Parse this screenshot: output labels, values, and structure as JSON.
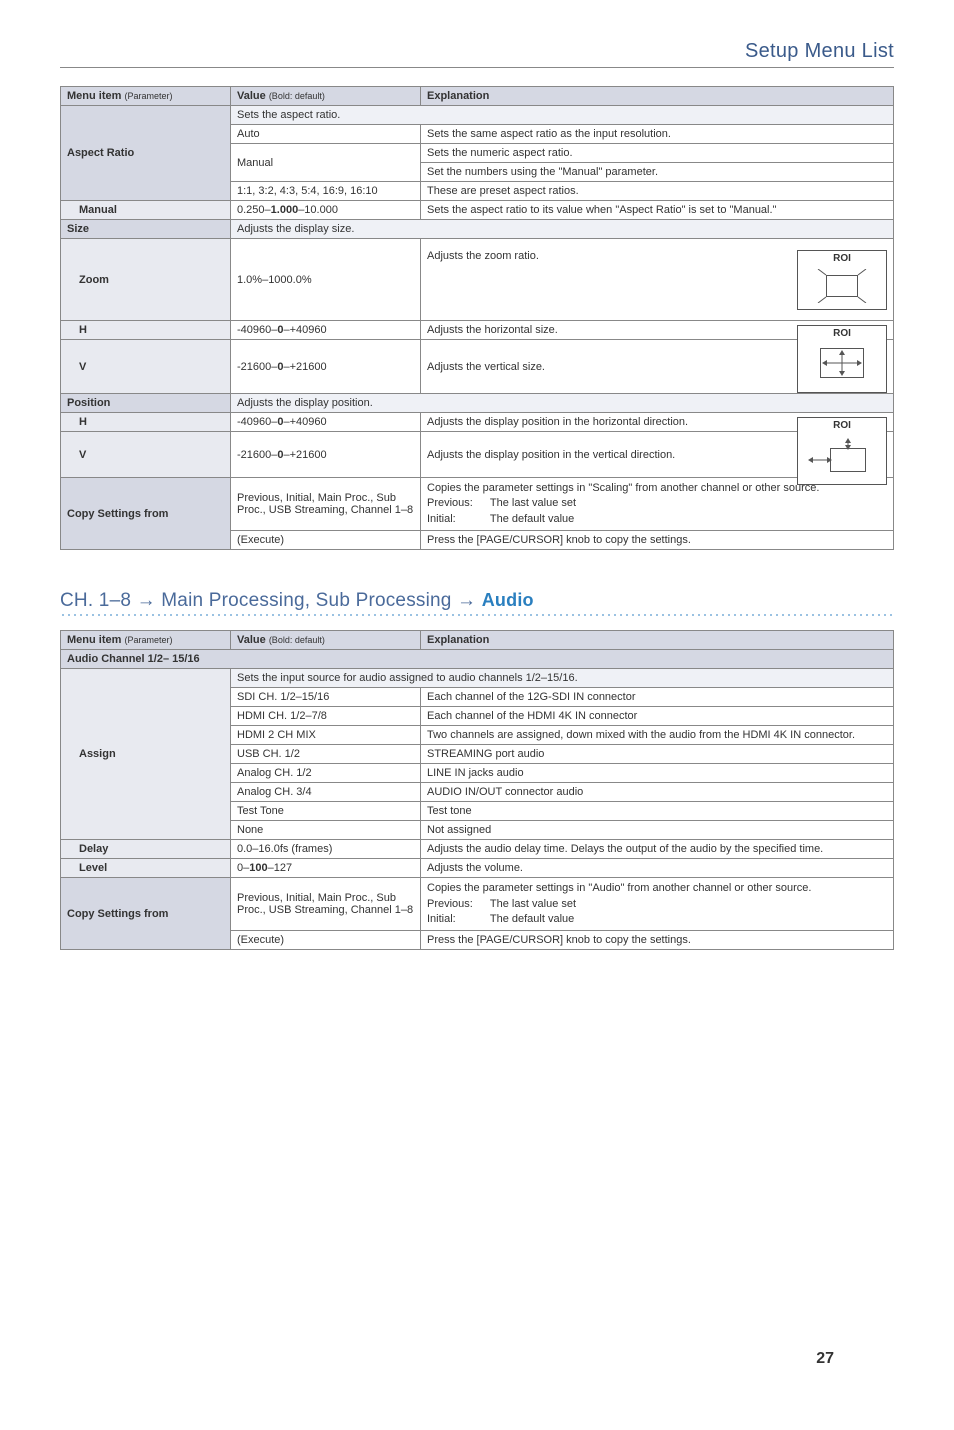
{
  "header": {
    "title": "Setup Menu List"
  },
  "columns": {
    "menu_item": "Menu item",
    "menu_item_sub": "(Parameter)",
    "value": "Value",
    "value_sub": "(Bold: default)",
    "explanation": "Explanation"
  },
  "table1": {
    "aspect_ratio": {
      "label": "Aspect Ratio",
      "intro": "Sets the aspect ratio.",
      "rows": [
        {
          "value": "Auto",
          "exp": "Sets the same aspect ratio as the input resolution."
        },
        {
          "value": "Manual",
          "exp1": "Sets the numeric aspect ratio.",
          "exp2": "Set the numbers using the \"Manual\" parameter."
        },
        {
          "value": "1:1, 3:2, 4:3, 5:4, 16:9, 16:10",
          "exp": "These are preset aspect ratios."
        }
      ],
      "manual": {
        "label": "Manual",
        "value_pre": "0.250–",
        "value_bold": "1.000",
        "value_post": "–10.000",
        "exp": "Sets the aspect ratio to its value when \"Aspect Ratio\" is set to \"Manual.\""
      }
    },
    "size": {
      "label": "Size",
      "intro": "Adjusts the display size.",
      "zoom": {
        "label": "Zoom",
        "value": "1.0%–1000.0%",
        "exp": "Adjusts the zoom ratio."
      },
      "h": {
        "label": "H",
        "value_pre": "-40960–",
        "value_bold": "0",
        "value_post": "–+40960",
        "exp": "Adjusts the horizontal size."
      },
      "v": {
        "label": "V",
        "value_pre": "-21600–",
        "value_bold": "0",
        "value_post": "–+21600",
        "exp": "Adjusts the vertical size."
      }
    },
    "position": {
      "label": "Position",
      "intro": "Adjusts the display position.",
      "h": {
        "label": "H",
        "value_pre": "-40960–",
        "value_bold": "0",
        "value_post": "–+40960",
        "exp": "Adjusts the display position in the horizontal direction."
      },
      "v": {
        "label": "V",
        "value_pre": "-21600–",
        "value_bold": "0",
        "value_post": "–+21600",
        "exp": "Adjusts the display position in the vertical direction."
      }
    },
    "copy": {
      "label": "Copy Settings from",
      "value": "Previous, Initial, Main Proc., Sub Proc., USB Streaming, Channel 1–8",
      "exp_intro": "Copies the parameter settings in \"Scaling\" from another channel or other source.",
      "prev_label": "Previous:",
      "prev_val": "The last value set",
      "init_label": "Initial:",
      "init_val": "The default value",
      "execute_value": "(Execute)",
      "execute_exp": "Press the [PAGE/CURSOR] knob to copy the settings."
    },
    "roi": "ROI"
  },
  "section2_heading": {
    "pre": "CH. 1–8 ",
    "mid": " Main Processing, Sub Processing ",
    "audio": "Audio"
  },
  "table2": {
    "section": "Audio Channel 1/2– 15/16",
    "assign": {
      "label": "Assign",
      "intro": "Sets the input source for audio assigned to audio channels 1/2–15/16.",
      "rows": [
        {
          "value": "SDI CH. 1/2–15/16",
          "exp": "Each channel of the 12G-SDI IN connector"
        },
        {
          "value": "HDMI CH. 1/2–7/8",
          "exp": "Each channel of the HDMI 4K IN connector"
        },
        {
          "value": "HDMI 2 CH MIX",
          "exp": "Two channels are assigned, down mixed with the audio from the HDMI 4K IN connector."
        },
        {
          "value": "USB CH. 1/2",
          "exp": "STREAMING port audio"
        },
        {
          "value": "Analog CH. 1/2",
          "exp": "LINE IN jacks audio"
        },
        {
          "value": "Analog CH. 3/4",
          "exp": "AUDIO IN/OUT connector audio"
        },
        {
          "value": "Test Tone",
          "exp": "Test tone"
        },
        {
          "value": "None",
          "exp": "Not assigned"
        }
      ]
    },
    "delay": {
      "label": "Delay",
      "value": "0.0–16.0fs (frames)",
      "exp": "Adjusts the audio delay time. Delays the output of the audio by the specified time."
    },
    "level": {
      "label": "Level",
      "value_pre": "0–",
      "value_bold": "100",
      "value_post": "–127",
      "exp": "Adjusts the volume."
    },
    "copy": {
      "label": "Copy Settings from",
      "value": "Previous, Initial, Main Proc., Sub Proc., USB Streaming, Channel 1–8",
      "exp_intro": "Copies the parameter settings in \"Audio\" from another channel or other source.",
      "prev_label": "Previous:",
      "prev_val": "The last value set",
      "init_label": "Initial:",
      "init_val": "The default value",
      "execute_value": "(Execute)",
      "execute_exp": "Press the [PAGE/CURSOR] knob to copy the settings."
    }
  },
  "page_number": "27"
}
